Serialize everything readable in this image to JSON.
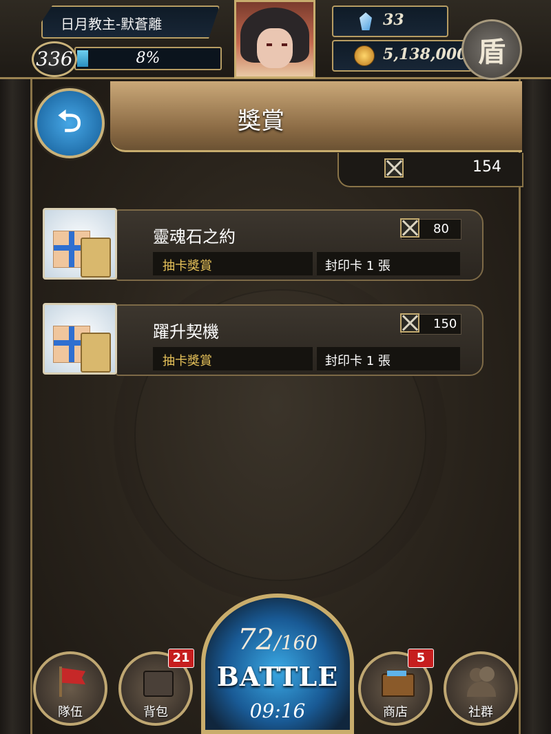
{
  "player": {
    "name": "日月教主-默蒼離",
    "level": "336",
    "exp_percent": "8%",
    "exp_fraction": 0.08
  },
  "currency": {
    "gems": "33",
    "gold": "5,138,000"
  },
  "menu_button_icon": "盾",
  "header": {
    "title": "獎賞",
    "back_icon": "⮌"
  },
  "total": {
    "icon": "crossed-swords-icon",
    "value": "154"
  },
  "rewards": [
    {
      "title": "靈魂石之約",
      "cost": "80",
      "tag": "抽卡獎賞",
      "reward": "封印卡 1 張"
    },
    {
      "title": "躍升契機",
      "cost": "150",
      "tag": "抽卡獎賞",
      "reward": "封印卡 1 張"
    }
  ],
  "nav": {
    "team": "隊伍",
    "bag": "背包",
    "bag_badge": "21",
    "shop": "商店",
    "shop_badge": "5",
    "social": "社群"
  },
  "battle": {
    "stamina_current": "72",
    "stamina_max": "/160",
    "label": "BATTLE",
    "timer": "09:16"
  },
  "colors": {
    "accent_gold": "#c9ad6c",
    "tag_gold": "#e6c25a",
    "battle_blue": "#195a95",
    "badge_red": "#c61e1e"
  }
}
